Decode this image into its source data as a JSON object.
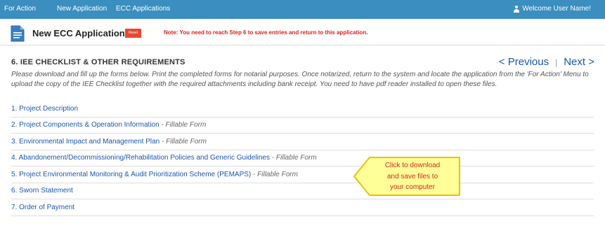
{
  "topbar": {
    "nav": [
      "For Action",
      "New Application",
      "ECC Applications"
    ],
    "user_greeting": "Welcome User Name!"
  },
  "header": {
    "title": "New ECC Application",
    "reset_label": "Reset",
    "note": "Note: You need to reach Step 6 to save entries and return to this application."
  },
  "section": {
    "title": "6. IEE CHECKLIST & OTHER REQUIREMENTS",
    "previous": "< Previous",
    "next": "Next >",
    "instructions": "Please download and fill up the forms below. Print the completed forms for notarial purposes. Once notarized, return to the system and locate the application from the 'For Action' Menu to upload the copy of the IEE Checklist together with the required attachments including bank receipt. You need to have pdf reader installed to open these files."
  },
  "documents": [
    {
      "label": "1. Project Description",
      "suffix": ""
    },
    {
      "label": "2. Project Components & Operation Information",
      "suffix": " - Fillable Form"
    },
    {
      "label": "3. Environmental Impact and Management Plan",
      "suffix": " - Fillable Form"
    },
    {
      "label": "4. Abandonement/Decommissioning/Rehabilitation Policies and Generic Guidelines",
      "suffix": " - Fillable Form"
    },
    {
      "label": "5. Project Environmental Monitoring & Audit Prioritization Scheme (PEMAPS)",
      "suffix": " - Fillable Form"
    },
    {
      "label": "6. Sworn Statement",
      "suffix": ""
    },
    {
      "label": "7. Order of Payment",
      "suffix": ""
    }
  ],
  "callout": {
    "lines": [
      "Click to download",
      "and save files to",
      "your computer"
    ]
  },
  "colors": {
    "topbar": "#3a8ec0",
    "link": "#1a56b0",
    "note": "#d9231f",
    "reset": "#e8472f",
    "callout_fill": "#ffff99",
    "callout_border": "#e8c200"
  }
}
